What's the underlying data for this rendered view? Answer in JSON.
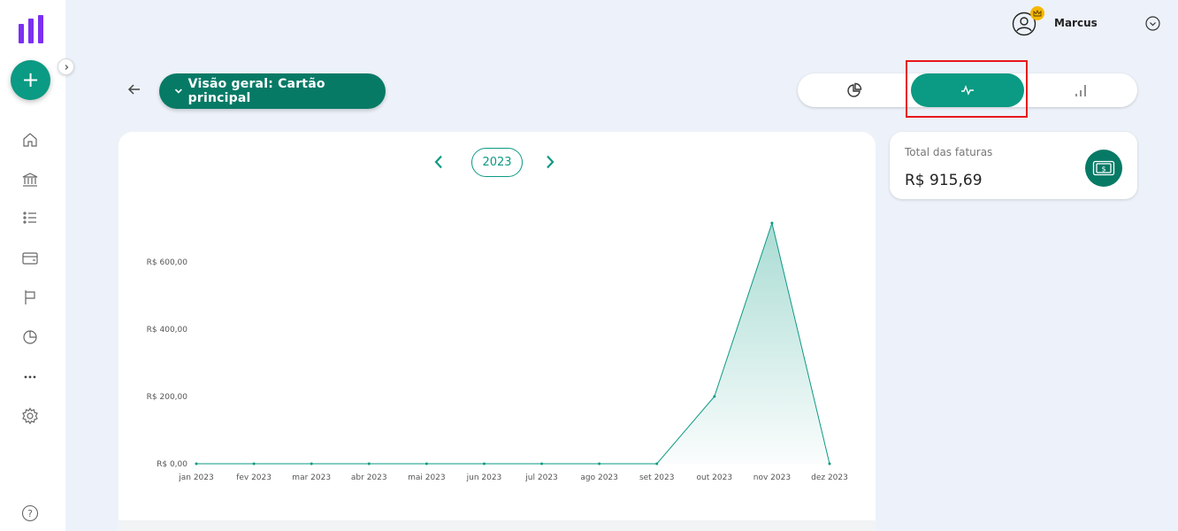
{
  "app": {
    "logo": "app-logo"
  },
  "sidebar": {
    "fab_label": "+",
    "items": [
      {
        "icon": "home-icon"
      },
      {
        "icon": "bank-icon"
      },
      {
        "icon": "list-icon"
      },
      {
        "icon": "wallet-icon"
      },
      {
        "icon": "flag-icon"
      },
      {
        "icon": "pie-chart-icon"
      },
      {
        "icon": "more-icon"
      },
      {
        "icon": "settings-icon"
      }
    ],
    "help_label": "?"
  },
  "header": {
    "user_name": "Marcus"
  },
  "topbar": {
    "title": "Visão geral: Cartão principal",
    "views": [
      {
        "icon": "pie-chart-icon",
        "active": false
      },
      {
        "icon": "line-chart-icon",
        "active": true
      },
      {
        "icon": "bar-chart-icon",
        "active": false
      }
    ]
  },
  "year_selector": {
    "year": "2023"
  },
  "summary": {
    "label": "Total das faturas",
    "value": "R$ 915,69"
  },
  "colors": {
    "accent": "#0b9a83",
    "accent_dark": "#077a66",
    "brand": "#7b2ff2",
    "highlight": "#e8161c",
    "crown": "#f5b800"
  },
  "chart_data": {
    "type": "area",
    "categories": [
      "jan 2023",
      "fev 2023",
      "mar 2023",
      "abr 2023",
      "mai 2023",
      "jun 2023",
      "jul 2023",
      "ago 2023",
      "set 2023",
      "out 2023",
      "nov 2023",
      "dez 2023"
    ],
    "values": [
      0,
      0,
      0,
      0,
      0,
      0,
      0,
      0,
      0,
      200,
      715.69,
      0
    ],
    "yticks": [
      {
        "value": 0,
        "label": "R$ 0,00"
      },
      {
        "value": 200,
        "label": "R$ 200,00"
      },
      {
        "value": 400,
        "label": "R$ 400,00"
      },
      {
        "value": 600,
        "label": "R$ 600,00"
      }
    ],
    "ylim": [
      0,
      750
    ],
    "grid": false,
    "color": "#0b9a83"
  }
}
